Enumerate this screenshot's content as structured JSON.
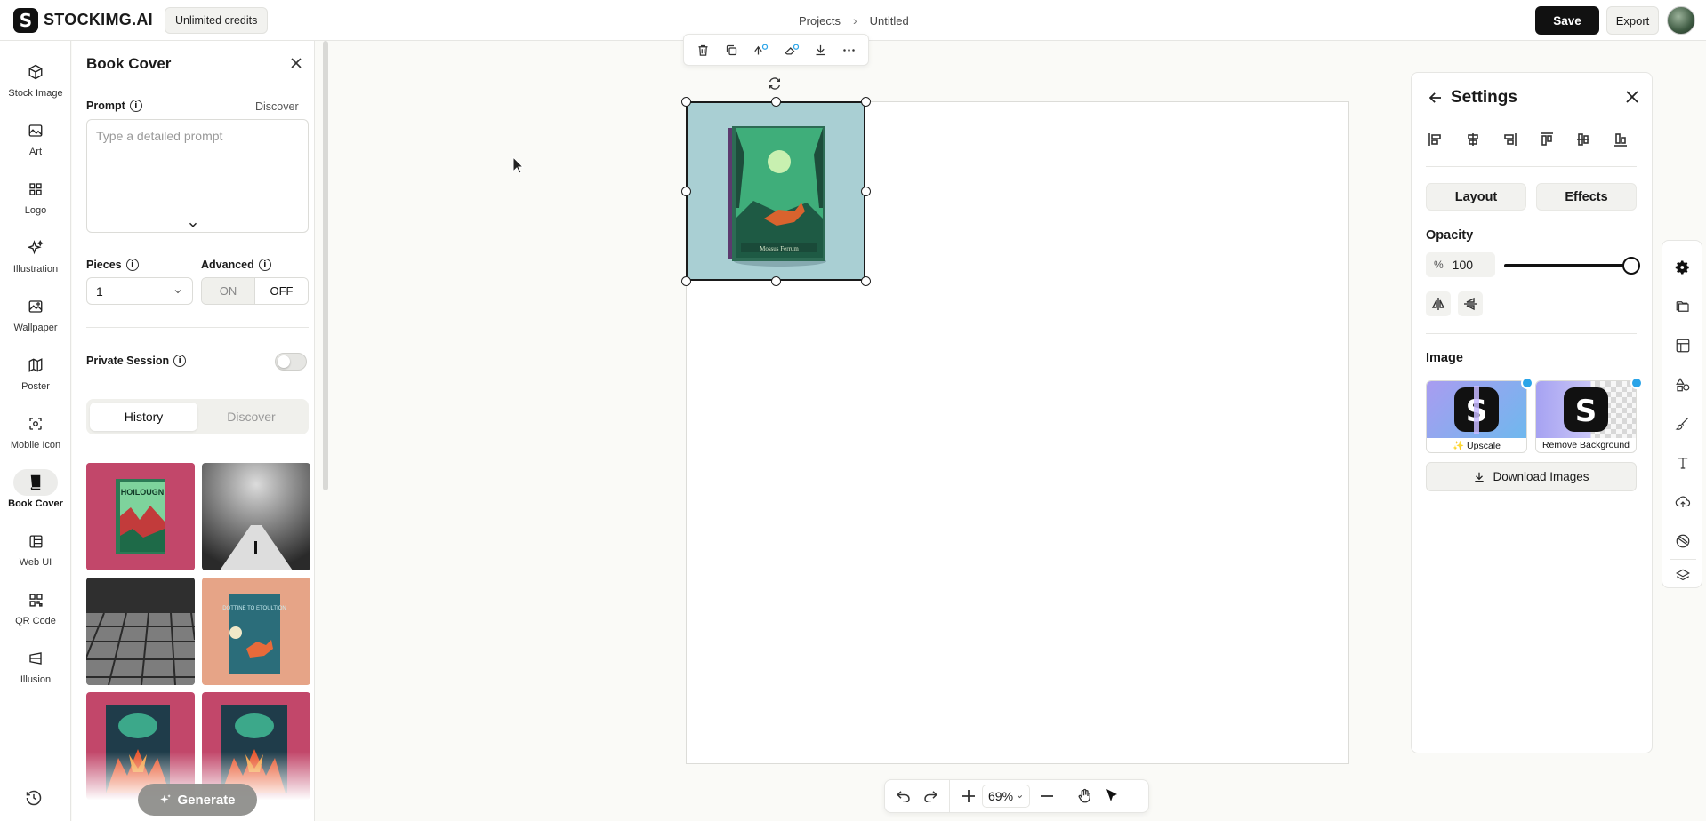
{
  "brand": {
    "name": "STOCKIMG.AI",
    "logo_letter": "S"
  },
  "credits_label": "Unlimited credits",
  "breadcrumb": {
    "parent": "Projects",
    "current": "Untitled"
  },
  "actions": {
    "save": "Save",
    "export": "Export"
  },
  "nav": {
    "items": [
      {
        "label": "Stock Image",
        "icon": "cube-icon"
      },
      {
        "label": "Art",
        "icon": "image-icon"
      },
      {
        "label": "Logo",
        "icon": "grid-icon"
      },
      {
        "label": "Illustration",
        "icon": "sparkles-icon"
      },
      {
        "label": "Wallpaper",
        "icon": "landscape-icon"
      },
      {
        "label": "Poster",
        "icon": "map-icon"
      },
      {
        "label": "Mobile Icon",
        "icon": "scan-icon"
      },
      {
        "label": "Book Cover",
        "icon": "book-icon"
      },
      {
        "label": "Web UI",
        "icon": "layout-icon"
      },
      {
        "label": "QR Code",
        "icon": "qr-icon"
      },
      {
        "label": "Illusion",
        "icon": "illusion-icon"
      }
    ],
    "active": "Book Cover"
  },
  "panel": {
    "title": "Book Cover",
    "prompt_label": "Prompt",
    "prompt_discover": "Discover",
    "prompt_placeholder": "Type a detailed prompt",
    "pieces_label": "Pieces",
    "pieces_value": "1",
    "advanced_label": "Advanced",
    "advanced_on": "ON",
    "advanced_off": "OFF",
    "private_label": "Private Session",
    "private_enabled": false,
    "tabs": [
      "History",
      "Discover"
    ],
    "active_tab": "History",
    "thumb_texts": [
      "HOILOUGN",
      "DOTTINE TO ETOULTION"
    ],
    "generate_label": "Generate"
  },
  "canvas": {
    "zoom": "69%",
    "book_caption": "Mossus Ferrum"
  },
  "settings": {
    "title": "Settings",
    "tabs": [
      "Layout",
      "Effects"
    ],
    "opacity_label": "Opacity",
    "opacity_unit": "%",
    "opacity_value": "100",
    "opacity_fraction": 1.0,
    "image_label": "Image",
    "cards": [
      {
        "label": "✨ Upscale"
      },
      {
        "label": "Remove Background"
      }
    ],
    "download_label": "Download Images"
  }
}
